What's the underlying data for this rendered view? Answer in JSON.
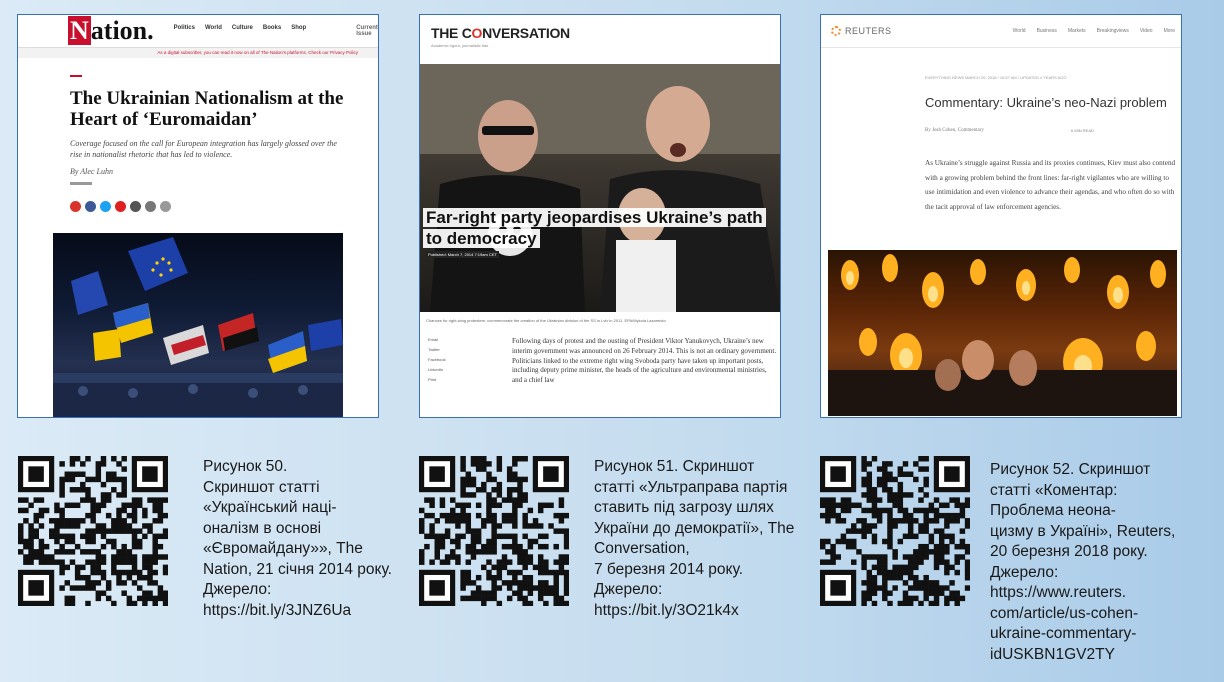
{
  "panels": {
    "nation": {
      "logo_initial": "N",
      "logo_rest": "ation.",
      "nav": [
        "Politics",
        "World",
        "Culture",
        "Books",
        "Shop",
        "Current Issue"
      ],
      "alert": "As a digital subscriber, you can read it now on all of The Nation's platforms. Check our Privacy Policy",
      "title": "The Ukrainian Nationalism at the Heart of ‘Euromaidan’",
      "dek": "Coverage focused on the call for European integration has largely glossed over the rise in nationalist rhetoric that has led to violence.",
      "byline": "By Alec Luhn"
    },
    "conversation": {
      "logo_pre": "THE C",
      "logo_o": "O",
      "logo_post": "NVERSATION",
      "tagline": "Academic rigour, journalistic flair",
      "title": "Far-right party jeopardises Ukraine’s path to democracy",
      "published": "Published: March 7, 2014 7:19am CET",
      "photo_caption": "Chances for right-wing protesters: commemorate the creation of the Ukrainian division of the SS in Lviv in 2011. EPA/Mykola Lazarenko",
      "share": [
        "Email",
        "Twitter",
        "Facebook",
        "LinkedIn",
        "Print"
      ],
      "body": "Following days of protest and the ousting of President Viktor Yanukovych, Ukraine’s new interim government was announced on 26 February 2014. This is not an ordinary government. Politicians linked to the extreme right wing Svoboda party have taken up important posts, including deputy prime minister, the heads of the agriculture and environmental ministries, and a chief law"
    },
    "reuters": {
      "logo": "REUTERS",
      "nav": [
        "World",
        "Business",
        "Markets",
        "Breakingviews",
        "Video",
        "More"
      ],
      "kicker": "EVERYTHING NEWS   MARCH 20, 2018 / 10:57 AM / UPDATED 4 YEARS AGO",
      "title": "Commentary: Ukraine’s neo-Nazi problem",
      "byline": "By Josh Cohen, Commentary",
      "read_time": "6 MIN READ",
      "body": "As Ukraine’s struggle against Russia and its proxies continues, Kiev must also contend with a growing problem behind the front lines: far-right vigilantes who are willing to use intimidation and even violence to advance their agendas, and who often do so with the tacit approval of law enforcement agencies."
    }
  },
  "captions": [
    "Рисунок 50.\nСкриншот статті «Український наці-\nоналізм в основі «Євромайдану»», The Nation, 21 січня 2014 року. Джерело: https://bit.ly/3JNZ6Ua",
    "Рисунок 51. Скриншот статті «Ультраправа партія ставить під загрозу шлях України до демократії», The Conversation,\n7 березня 2014 року. Джерело:\nhttps://bit.ly/3O21k4x",
    "Рисунок 52. Скриншот статті «Коментар: Проблема неона-\nцизму в Україні», Reuters, 20 березня 2018 року. Джерело: https://www.reuters.\ncom/article/us-cohen-ukraine-commentary-idUSKBN1GV2TY"
  ],
  "colors": {
    "panel_border": "#3b6fb5",
    "nation_red": "#c8102e",
    "conversation_red": "#d8352a",
    "reuters_orange": "#f28c28"
  }
}
